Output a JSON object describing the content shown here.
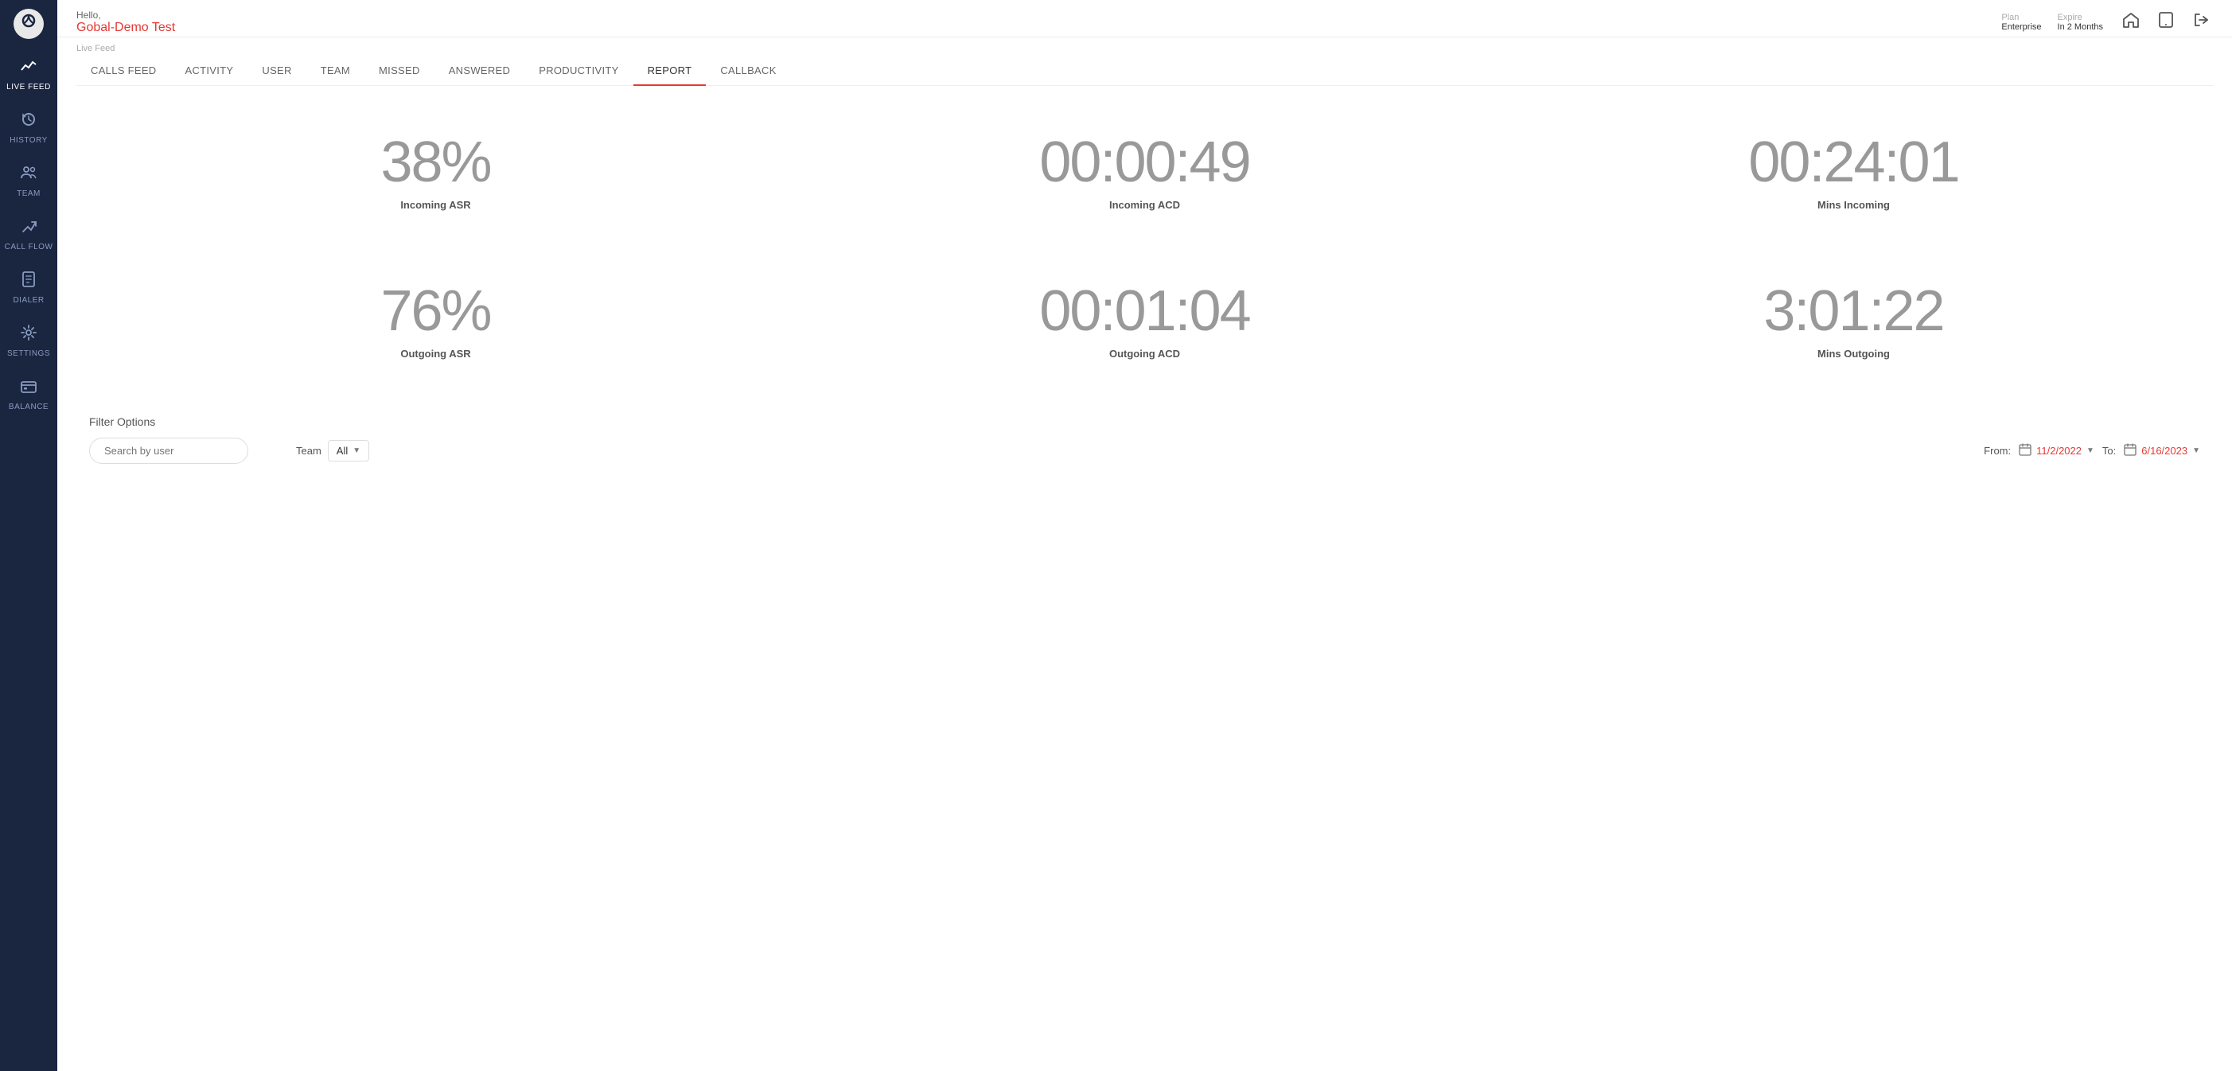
{
  "sidebar": {
    "logo": "O",
    "items": [
      {
        "id": "live-feed",
        "label": "LIVE FEED",
        "icon": "📈",
        "active": true
      },
      {
        "id": "history",
        "label": "HISTORY",
        "icon": "📞"
      },
      {
        "id": "team",
        "label": "TEAM",
        "icon": "👥"
      },
      {
        "id": "call-flow",
        "label": "CALL FLOW",
        "icon": "⤴"
      },
      {
        "id": "dialer",
        "label": "DIALER",
        "icon": "📲"
      },
      {
        "id": "settings",
        "label": "SETTINGS",
        "icon": "⚙"
      },
      {
        "id": "balance",
        "label": "BALANCE",
        "icon": "💳"
      }
    ]
  },
  "header": {
    "hello": "Hello,",
    "name": "Gobal-Demo Test",
    "plan_label": "Plan",
    "plan_value": "Enterprise",
    "expire_label": "Expire",
    "expire_value": "In 2 Months"
  },
  "live_feed_label": "Live Feed",
  "tabs": [
    {
      "id": "calls-feed",
      "label": "CALLS FEED"
    },
    {
      "id": "activity",
      "label": "ACTIVITY"
    },
    {
      "id": "user",
      "label": "USER"
    },
    {
      "id": "team",
      "label": "TEAM"
    },
    {
      "id": "missed",
      "label": "MISSED"
    },
    {
      "id": "answered",
      "label": "ANSWERED"
    },
    {
      "id": "productivity",
      "label": "PRODUCTIVITY"
    },
    {
      "id": "report",
      "label": "REPORT",
      "active": true
    },
    {
      "id": "callback",
      "label": "CALLBACK"
    }
  ],
  "stats": [
    {
      "id": "incoming-asr",
      "value": "38%",
      "label": "Incoming ASR"
    },
    {
      "id": "incoming-acd",
      "value": "00:00:49",
      "label": "Incoming ACD"
    },
    {
      "id": "mins-incoming",
      "value": "00:24:01",
      "label": "Mins Incoming"
    },
    {
      "id": "outgoing-asr",
      "value": "76%",
      "label": "Outgoing ASR"
    },
    {
      "id": "outgoing-acd",
      "value": "00:01:04",
      "label": "Outgoing ACD"
    },
    {
      "id": "mins-outgoing",
      "value": "3:01:22",
      "label": "Mins Outgoing"
    }
  ],
  "filter": {
    "title": "Filter Options",
    "search_placeholder": "Search by user",
    "team_label": "Team",
    "team_value": "All",
    "from_label": "From:",
    "from_date": "11/2/2022",
    "to_label": "To:",
    "to_date": "6/16/2023"
  }
}
